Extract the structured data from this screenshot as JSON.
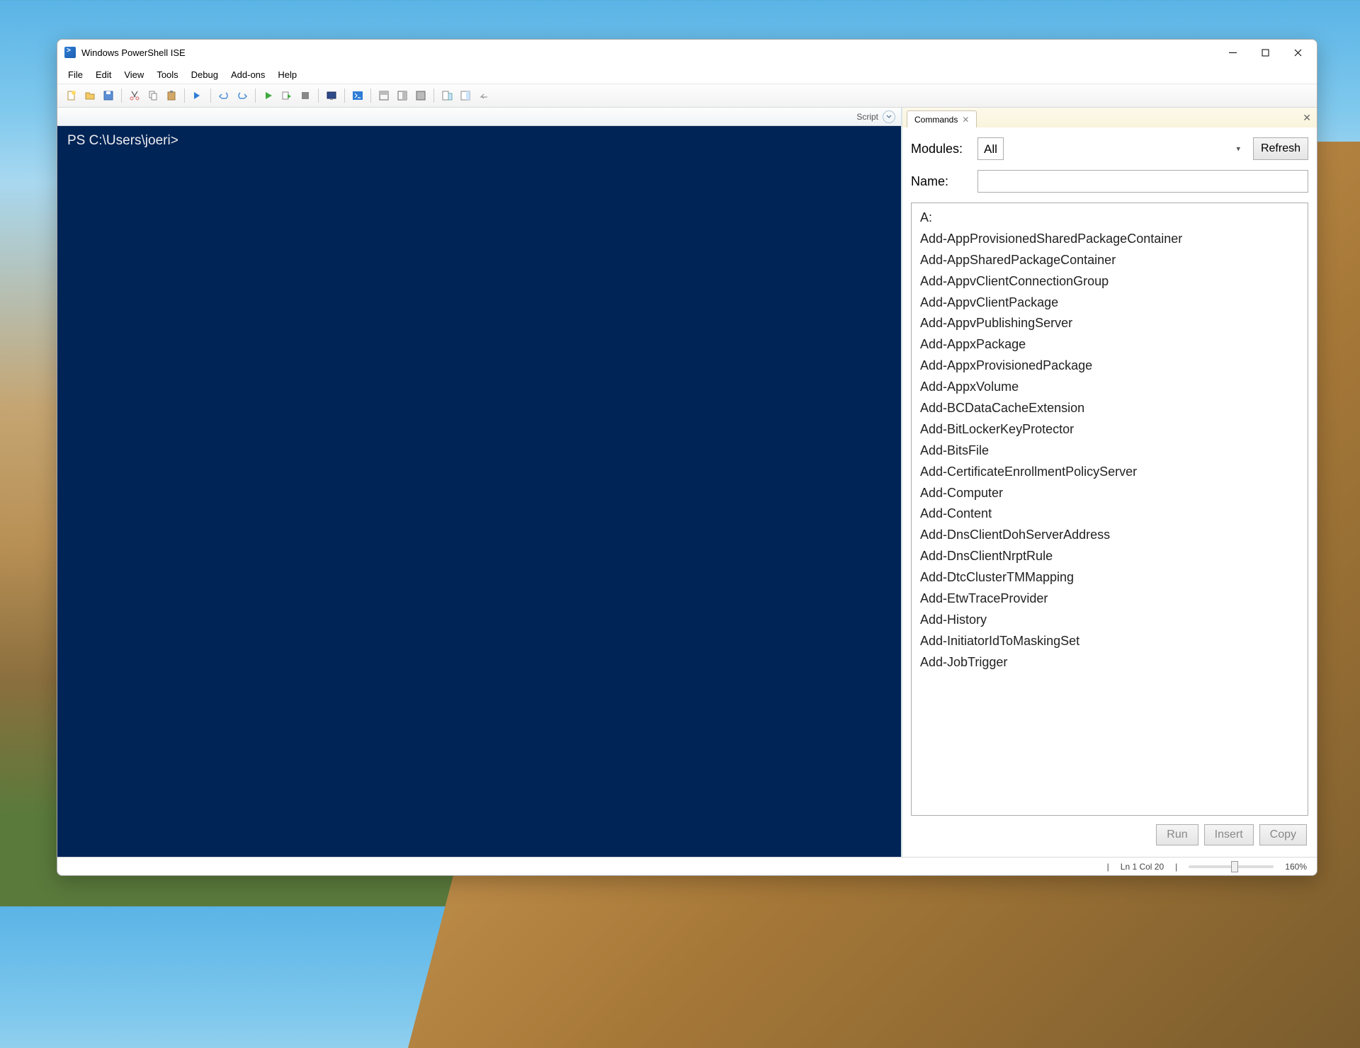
{
  "window": {
    "title": "Windows PowerShell ISE"
  },
  "menu": {
    "items": [
      "File",
      "Edit",
      "View",
      "Tools",
      "Debug",
      "Add-ons",
      "Help"
    ]
  },
  "script_label": "Script",
  "console": {
    "prompt": "PS C:\\Users\\joeri>"
  },
  "commands_panel": {
    "tab_label": "Commands",
    "modules_label": "Modules:",
    "modules_value": "All",
    "name_label": "Name:",
    "name_value": "",
    "refresh_label": "Refresh",
    "list": [
      "A:",
      "Add-AppProvisionedSharedPackageContainer",
      "Add-AppSharedPackageContainer",
      "Add-AppvClientConnectionGroup",
      "Add-AppvClientPackage",
      "Add-AppvPublishingServer",
      "Add-AppxPackage",
      "Add-AppxProvisionedPackage",
      "Add-AppxVolume",
      "Add-BCDataCacheExtension",
      "Add-BitLockerKeyProtector",
      "Add-BitsFile",
      "Add-CertificateEnrollmentPolicyServer",
      "Add-Computer",
      "Add-Content",
      "Add-DnsClientDohServerAddress",
      "Add-DnsClientNrptRule",
      "Add-DtcClusterTMMapping",
      "Add-EtwTraceProvider",
      "Add-History",
      "Add-InitiatorIdToMaskingSet",
      "Add-JobTrigger"
    ],
    "actions": {
      "run": "Run",
      "insert": "Insert",
      "copy": "Copy"
    }
  },
  "status": {
    "position": "Ln 1  Col 20",
    "zoom": "160%"
  },
  "colors": {
    "console_bg": "#012456",
    "accent": "#2e7cd6"
  }
}
